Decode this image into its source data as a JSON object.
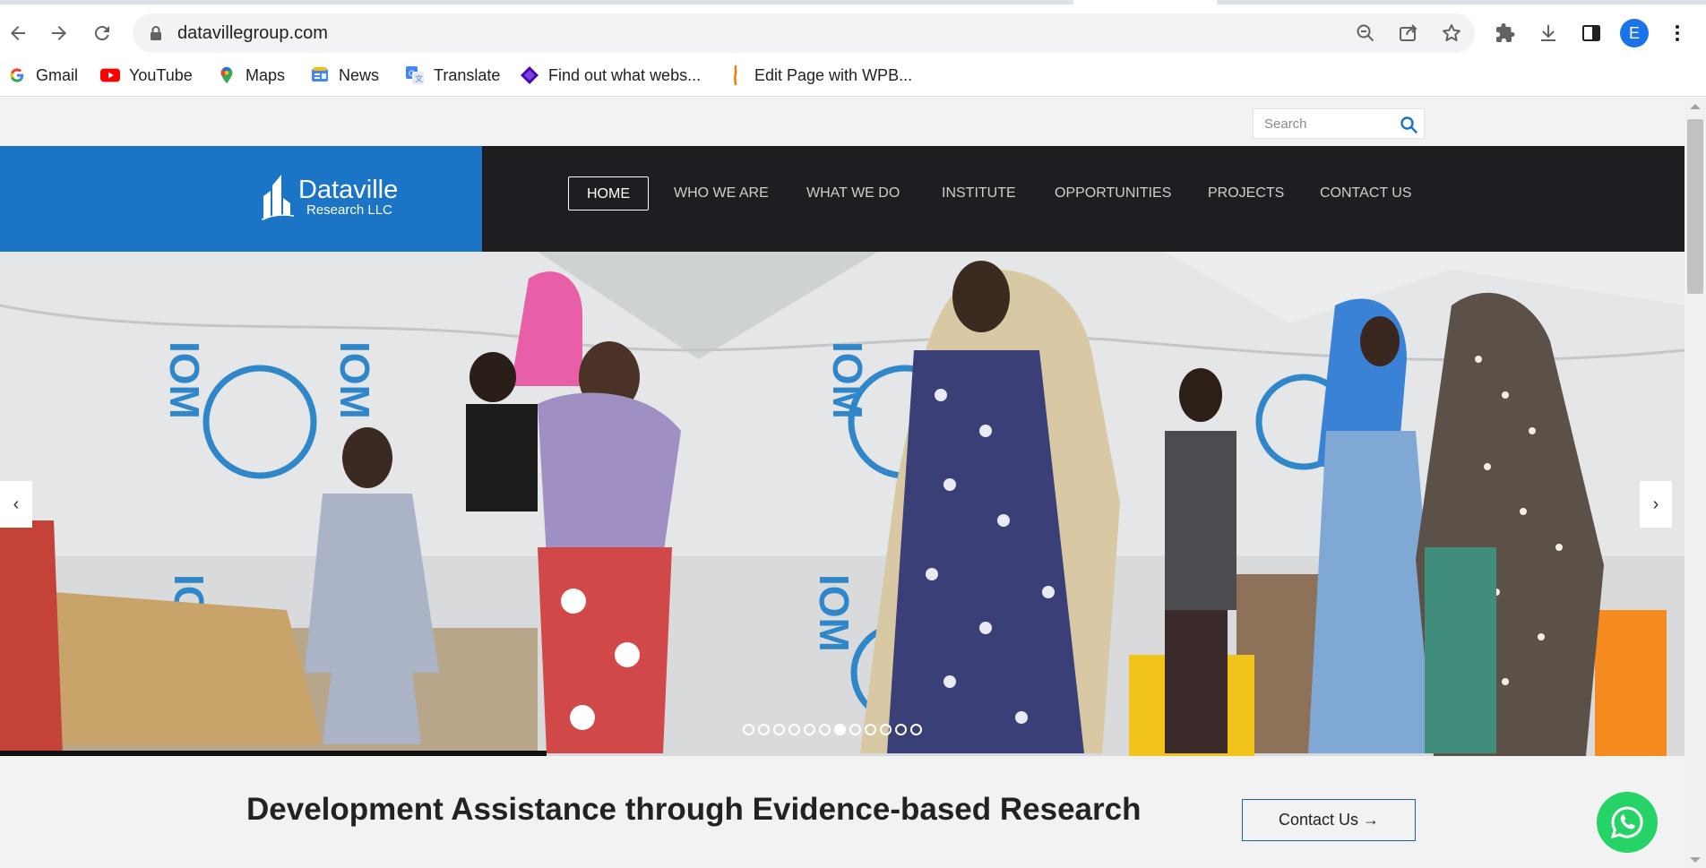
{
  "browser": {
    "url": "datavillegroup.com",
    "profile_initial": "E",
    "bookmarks": [
      {
        "label": "Gmail",
        "icon": "google-icon"
      },
      {
        "label": "YouTube",
        "icon": "youtube-icon"
      },
      {
        "label": "Maps",
        "icon": "maps-icon"
      },
      {
        "label": "News",
        "icon": "news-icon"
      },
      {
        "label": "Translate",
        "icon": "translate-icon"
      },
      {
        "label": "Find out what webs...",
        "icon": "wappalyzer-icon"
      },
      {
        "label": "Edit Page with WPB...",
        "icon": "wpbakery-icon"
      }
    ]
  },
  "site": {
    "search_placeholder": "Search",
    "logo_name": "Dataville",
    "logo_sub": "Research LLC",
    "nav": [
      "HOME",
      "WHO WE ARE",
      "WHAT WE DO",
      "INSTITUTE",
      "OPPORTUNITIES",
      "PROJECTS",
      "CONTACT US"
    ],
    "slider": {
      "prev": "‹",
      "next": "›",
      "slide_count": 12,
      "active_slide_index": 6
    },
    "tagline": "Development Assistance through Evidence-based Research",
    "contact_button": "Contact Us →",
    "colors": {
      "brand_blue": "#1b74c5",
      "header_dark": "#1e1e22",
      "whatsapp_green": "#25d366"
    }
  }
}
